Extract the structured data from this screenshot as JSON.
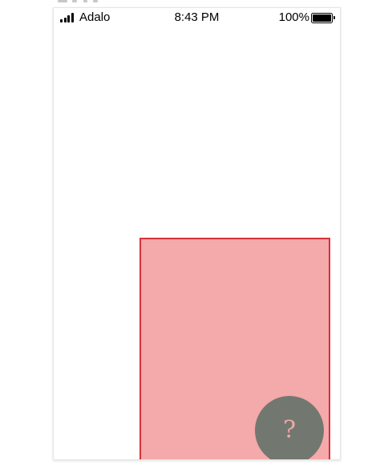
{
  "status_bar": {
    "carrier": "Adalo",
    "time": "8:43 PM",
    "battery_percent": "100%",
    "battery_level": 1.0,
    "signal_bars": 4
  },
  "help_button": {
    "label": "?"
  },
  "colors": {
    "box_fill": "#f4a9aa",
    "box_border": "#d6333b",
    "help_button_bg": "#727870",
    "help_button_text": "#f0a7a6"
  },
  "icons": {
    "signal": "signal-strength-icon",
    "battery": "battery-icon"
  }
}
